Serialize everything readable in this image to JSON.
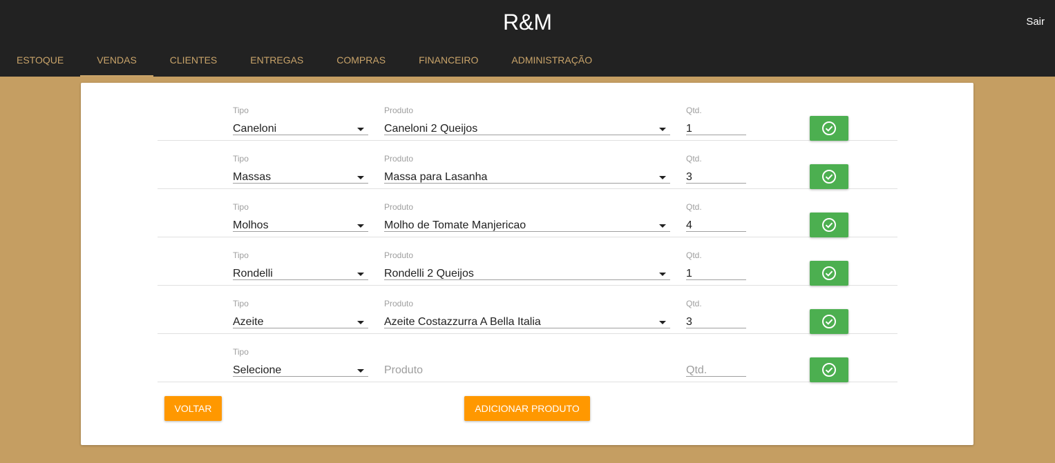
{
  "header": {
    "title": "R&M",
    "logout_label": "Sair"
  },
  "tabs": [
    {
      "label": "ESTOQUE",
      "active": false
    },
    {
      "label": "VENDAS",
      "active": true
    },
    {
      "label": "CLIENTES",
      "active": false
    },
    {
      "label": "ENTREGAS",
      "active": false
    },
    {
      "label": "COMPRAS",
      "active": false
    },
    {
      "label": "FINANCEIRO",
      "active": false
    },
    {
      "label": "ADMINISTRAÇÃO",
      "active": false
    }
  ],
  "form": {
    "labels": {
      "tipo": "Tipo",
      "produto": "Produto",
      "qtd": "Qtd."
    },
    "rows": [
      {
        "tipo": "Caneloni",
        "produto": "Caneloni 2 Queijos",
        "qtd": "1"
      },
      {
        "tipo": "Massas",
        "produto": "Massa para Lasanha",
        "qtd": "3"
      },
      {
        "tipo": "Molhos",
        "produto": "Molho de Tomate Manjericao",
        "qtd": "4"
      },
      {
        "tipo": "Rondelli",
        "produto": "Rondelli 2 Queijos",
        "qtd": "1"
      },
      {
        "tipo": "Azeite",
        "produto": "Azeite Costazzurra A Bella Italia",
        "qtd": "3"
      }
    ],
    "new_row": {
      "tipo": "Selecione",
      "produto_placeholder": "Produto",
      "qtd_placeholder": "Qtd."
    }
  },
  "actions": {
    "back_label": "VOLTAR",
    "add_label": "ADICIONAR PRODUTO"
  },
  "colors": {
    "appbar": "#222222",
    "accent": "#c9a46a",
    "background": "#c59e62",
    "confirm": "#4caf50",
    "action": "#ff9800"
  },
  "icons": {
    "confirm": "check-circle-icon",
    "dropdown": "dropdown-arrow-icon"
  }
}
